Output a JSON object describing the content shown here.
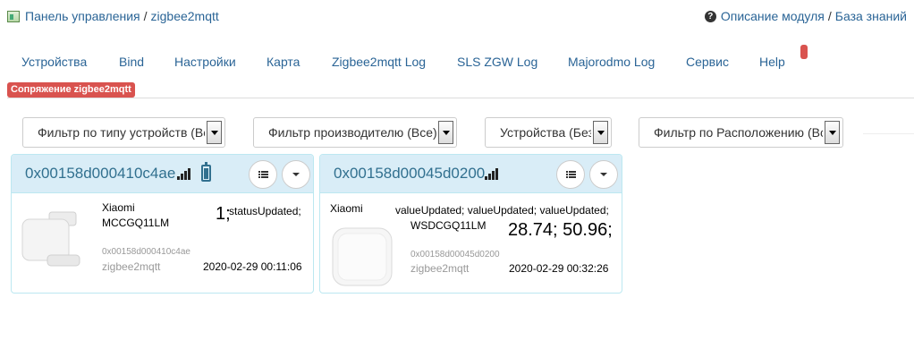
{
  "breadcrumb": {
    "control_panel": "Панель управления",
    "separator": "/",
    "module": "zigbee2mqtt"
  },
  "help": {
    "description": "Описание модуля",
    "separator": "/",
    "knowledge_base": "База знаний"
  },
  "nav": {
    "tabs": [
      {
        "label": "Устройства"
      },
      {
        "label": "Bind"
      },
      {
        "label": "Настройки"
      },
      {
        "label": "Карта"
      },
      {
        "label": "Zigbee2mqtt Log"
      },
      {
        "label": "SLS ZGW Log"
      },
      {
        "label": "Majorodmo Log"
      },
      {
        "label": "Сервис"
      },
      {
        "label": "Help"
      }
    ],
    "pairing_label": "Сопряжение zigbee2mqtt"
  },
  "filters": {
    "type": "Фильтр по типу устройств (Все)",
    "manufacturer": "Фильтр производителю (Все)",
    "devices": "Устройства (Без скрытых)",
    "location": "Фильтр по Расположению (Все)"
  },
  "devices": [
    {
      "id": "0x00158d000410c4ae",
      "signal_icon": "signal-icon",
      "battery_icon": "battery-icon",
      "vendor": "Xiaomi",
      "model": "MCCGQ11LM",
      "value": "1;",
      "status": "statusUpdated;",
      "ieee": "0x00158d000410c4ae",
      "source": "zigbee2mqtt",
      "timestamp": "2020-02-29 00:11:06"
    },
    {
      "id": "0x00158d00045d0200",
      "signal_icon": "signal-icon",
      "vendor": "Xiaomi",
      "model": "WSDCGQ11LM",
      "value": "28.74; 50.96;",
      "status": "valueUpdated; valueUpdated; valueUpdated;",
      "ieee": "0x00158d00045d0200",
      "source": "zigbee2mqtt",
      "timestamp": "2020-02-29 00:32:26"
    }
  ],
  "colors": {
    "link": "#2a6496",
    "panel_heading": "#d9edf7",
    "panel_border": "#bce8f1",
    "panel_title": "#31708f",
    "danger": "#d9534f"
  }
}
